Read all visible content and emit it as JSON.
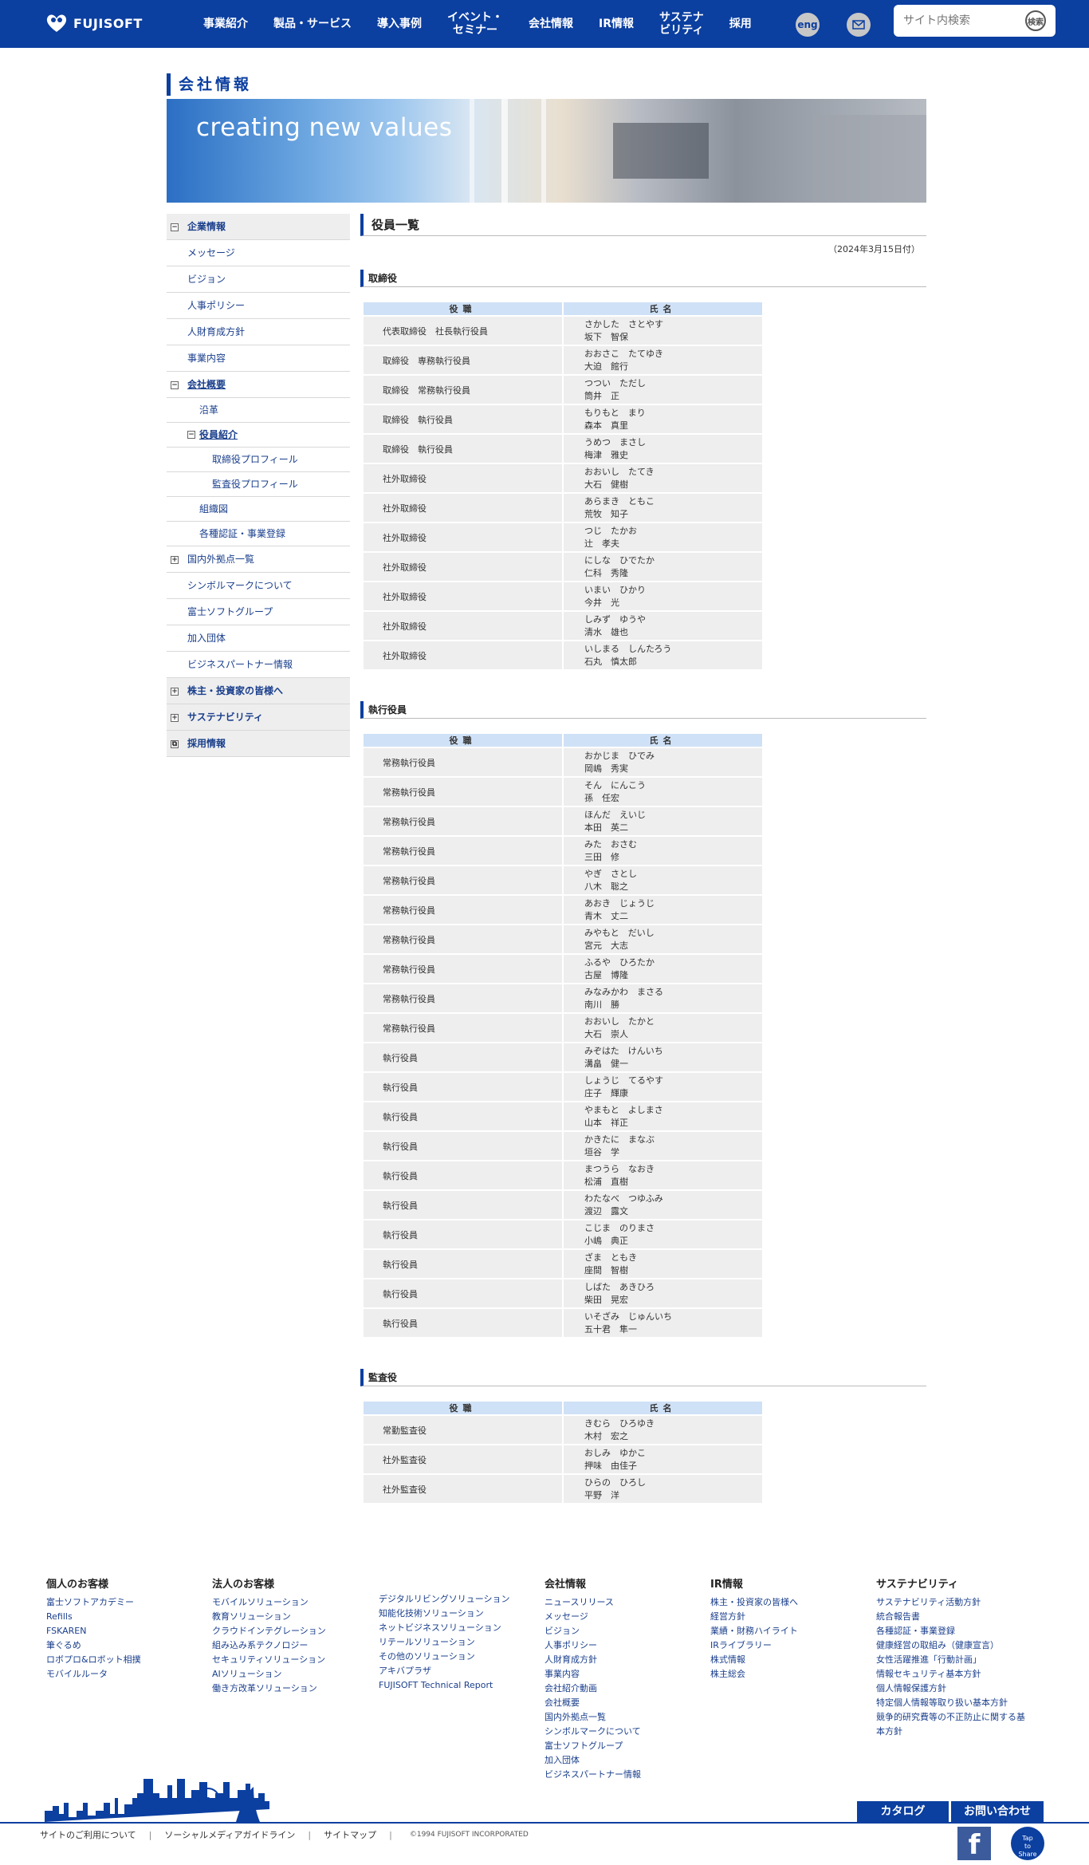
{
  "header": {
    "logo_text": "FUJISOFT",
    "nav": [
      "事業紹介",
      "製品・サービス",
      "導入事例",
      "イベント・\nセミナー",
      "会社情報",
      "IR情報",
      "サステナ\nビリティ",
      "採用"
    ],
    "eng_label": "eng",
    "search_placeholder": "サイト内検索",
    "search_button": "検索"
  },
  "page": {
    "heading": "会社情報",
    "banner_text": "creating new values",
    "title": "役員一覧",
    "date": "（2024年3月15日付）"
  },
  "sidebar": [
    {
      "label": "企業情報",
      "level": "top",
      "box": "−"
    },
    {
      "label": "メッセージ",
      "level": "lv2"
    },
    {
      "label": "ビジョン",
      "level": "lv2"
    },
    {
      "label": "人事ポリシー",
      "level": "lv2"
    },
    {
      "label": "人財育成方針",
      "level": "lv2"
    },
    {
      "label": "事業内容",
      "level": "lv2"
    },
    {
      "label": "会社概要",
      "level": "lv2",
      "box": "−",
      "selected": true
    },
    {
      "label": "沿革",
      "level": "lv3"
    },
    {
      "label": "役員紹介",
      "level": "lv3",
      "box": "−",
      "selected": true
    },
    {
      "label": "取締役プロフィール",
      "level": "lv4"
    },
    {
      "label": "監査役プロフィール",
      "level": "lv4"
    },
    {
      "label": "組織図",
      "level": "lv3"
    },
    {
      "label": "各種認証・事業登録",
      "level": "lv3"
    },
    {
      "label": "国内外拠点一覧",
      "level": "lv2",
      "box": "+"
    },
    {
      "label": "シンボルマークについて",
      "level": "lv2"
    },
    {
      "label": "富士ソフトグループ",
      "level": "lv2"
    },
    {
      "label": "加入団体",
      "level": "lv2"
    },
    {
      "label": "ビジネスパートナー情報",
      "level": "lv2"
    },
    {
      "label": "株主・投資家の皆様へ",
      "level": "top",
      "box": "+"
    },
    {
      "label": "サステナビリティ",
      "level": "top",
      "box": "+"
    },
    {
      "label": "採用情報",
      "level": "top",
      "box": "⧉"
    }
  ],
  "table_headers": {
    "role": "役職",
    "name": "氏名"
  },
  "sections": [
    {
      "title": "取締役",
      "rows": [
        {
          "role": "代表取締役　社長執行役員",
          "kana": "さかした　さとやす",
          "name": "坂下　智保"
        },
        {
          "role": "取締役　専務執行役員",
          "kana": "おおさこ　たてゆき",
          "name": "大迫　館行"
        },
        {
          "role": "取締役　常務執行役員",
          "kana": "つつい　ただし",
          "name": "筒井　正"
        },
        {
          "role": "取締役　執行役員",
          "kana": "もりもと　まり",
          "name": "森本　真里"
        },
        {
          "role": "取締役　執行役員",
          "kana": "うめつ　まさし",
          "name": "梅津　雅史"
        },
        {
          "role": "社外取締役",
          "kana": "おおいし　たてき",
          "name": "大石　健樹"
        },
        {
          "role": "社外取締役",
          "kana": "あらまき　ともこ",
          "name": "荒牧　知子"
        },
        {
          "role": "社外取締役",
          "kana": "つじ　たかお",
          "name": "辻　孝夫"
        },
        {
          "role": "社外取締役",
          "kana": "にしな　ひでたか",
          "name": "仁科　秀隆"
        },
        {
          "role": "社外取締役",
          "kana": "いまい　ひかり",
          "name": "今井　光"
        },
        {
          "role": "社外取締役",
          "kana": "しみず　ゆうや",
          "name": "清水　雄也"
        },
        {
          "role": "社外取締役",
          "kana": "いしまる　しんたろう",
          "name": "石丸　慎太郎"
        }
      ]
    },
    {
      "title": "執行役員",
      "rows": [
        {
          "role": "常務執行役員",
          "kana": "おかじま　ひでみ",
          "name": "岡嶋　秀実"
        },
        {
          "role": "常務執行役員",
          "kana": "そん　にんこう",
          "name": "孫　任宏"
        },
        {
          "role": "常務執行役員",
          "kana": "ほんだ　えいじ",
          "name": "本田　英二"
        },
        {
          "role": "常務執行役員",
          "kana": "みた　おさむ",
          "name": "三田　修"
        },
        {
          "role": "常務執行役員",
          "kana": "やぎ　さとし",
          "name": "八木　聡之"
        },
        {
          "role": "常務執行役員",
          "kana": "あおき　じょうじ",
          "name": "青木　丈二"
        },
        {
          "role": "常務執行役員",
          "kana": "みやもと　だいし",
          "name": "宮元　大志"
        },
        {
          "role": "常務執行役員",
          "kana": "ふるや　ひろたか",
          "name": "古屋　博隆"
        },
        {
          "role": "常務執行役員",
          "kana": "みなみかわ　まさる",
          "name": "南川　勝"
        },
        {
          "role": "常務執行役員",
          "kana": "おおいし　たかと",
          "name": "大石　崇人"
        },
        {
          "role": "執行役員",
          "kana": "みぞはた　けんいち",
          "name": "溝畠　健一"
        },
        {
          "role": "執行役員",
          "kana": "しょうじ　てるやす",
          "name": "庄子　輝康"
        },
        {
          "role": "執行役員",
          "kana": "やまもと　よしまさ",
          "name": "山本　祥正"
        },
        {
          "role": "執行役員",
          "kana": "かきたに　まなぶ",
          "name": "垣谷　学"
        },
        {
          "role": "執行役員",
          "kana": "まつうら　なおき",
          "name": "松浦　直樹"
        },
        {
          "role": "執行役員",
          "kana": "わたなべ　つゆふみ",
          "name": "渡辺　露文"
        },
        {
          "role": "執行役員",
          "kana": "こじま　のりまさ",
          "name": "小嶋　典正"
        },
        {
          "role": "執行役員",
          "kana": "ざま　ともき",
          "name": "座間　智樹"
        },
        {
          "role": "執行役員",
          "kana": "しばた　あきひろ",
          "name": "柴田　晃宏"
        },
        {
          "role": "執行役員",
          "kana": "いそざみ　じゅんいち",
          "name": "五十君　隼一"
        }
      ]
    },
    {
      "title": "監査役",
      "rows": [
        {
          "role": "常勤監査役",
          "kana": "きむら　ひろゆき",
          "name": "木村　宏之"
        },
        {
          "role": "社外監査役",
          "kana": "おしみ　ゆかこ",
          "name": "押味　由佳子"
        },
        {
          "role": "社外監査役",
          "kana": "ひらの　ひろし",
          "name": "平野　洋"
        }
      ]
    }
  ],
  "footer": {
    "columns": [
      {
        "title": "個人のお客様",
        "items": [
          "富士ソフトアカデミー",
          "Refills",
          "FSKAREN",
          "筆ぐるめ",
          "ロボプロ&ロボット相撲",
          "モバイルルータ"
        ]
      },
      {
        "title": "法人のお客様",
        "items": [
          "モバイルソリューション",
          "教育ソリューション",
          "クラウドインテグレーション",
          "組み込み系テクノロジー",
          "セキュリティソリューション",
          "AIソリューション",
          "働き方改革ソリューション"
        ]
      },
      {
        "title": "",
        "items": [
          "デジタルリビングソリューション",
          "知能化技術ソリューション",
          "ネットビジネスソリューション",
          "リテールソリューション",
          "その他のソリューション",
          "アキバプラザ",
          "FUJISOFT Technical Report"
        ]
      },
      {
        "title": "会社情報",
        "items": [
          "ニュースリリース",
          "メッセージ",
          "ビジョン",
          "人事ポリシー",
          "人財育成方針",
          "事業内容",
          "会社紹介動画",
          "会社概要",
          "国内外拠点一覧",
          "シンボルマークについて",
          "富士ソフトグループ",
          "加入団体",
          "ビジネスパートナー情報"
        ]
      },
      {
        "title": "IR情報",
        "items": [
          "株主・投資家の皆様へ",
          "経営方針",
          "業績・財務ハイライト",
          "IRライブラリー",
          "株式情報",
          "株主総会"
        ]
      },
      {
        "title": "サステナビリティ",
        "items": [
          "サステナビリティ活動方針",
          "統合報告書",
          "各種認証・事業登録",
          "健康経営の取組み（健康宣言）",
          "女性活躍推進「行動計画」",
          "情報セキュリティ基本方針",
          "個人情報保護方針",
          "特定個人情報等取り扱い基本方針",
          "競争的研究費等の不正防止に関する基",
          "本方針"
        ]
      }
    ],
    "catalog_button": "カタログ",
    "contact_button": "お問い合わせ",
    "bottom_links": [
      "サイトのご利用について",
      "ソーシャルメディアガイドライン",
      "サイトマップ"
    ],
    "copyright": "©1994 FUJISOFT INCORPORATED",
    "facebook": "f",
    "share": "Tap\nto\nShare"
  },
  "colors": {
    "brand": "#0b3fa0",
    "table_header": "#cfe1f6",
    "row_bg": "#eeeeee"
  }
}
